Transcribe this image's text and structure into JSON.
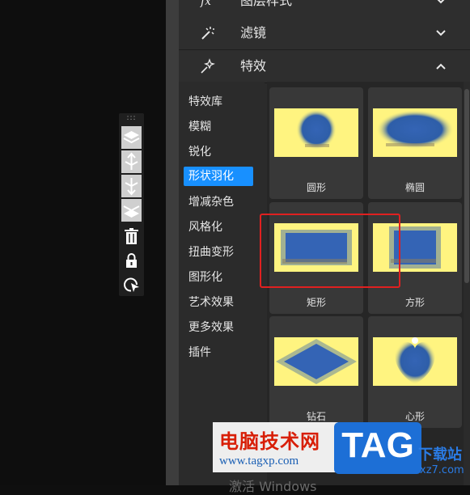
{
  "panel": {
    "sections": [
      {
        "label": "图层样式",
        "icon": "fx-icon",
        "state": "collapsed"
      },
      {
        "label": "滤镜",
        "icon": "magic-wand-icon",
        "state": "collapsed"
      },
      {
        "label": "特效",
        "icon": "sparkle-wand-icon",
        "state": "expanded"
      }
    ],
    "effect_categories": [
      {
        "label": "特效库"
      },
      {
        "label": "模糊"
      },
      {
        "label": "锐化"
      },
      {
        "label": "形状羽化",
        "selected": true
      },
      {
        "label": "增减杂色"
      },
      {
        "label": "风格化"
      },
      {
        "label": "扭曲变形"
      },
      {
        "label": "图形化"
      },
      {
        "label": "艺术效果"
      },
      {
        "label": "更多效果"
      },
      {
        "label": "插件"
      }
    ],
    "presets": [
      {
        "label": "圆形",
        "shape": "circle"
      },
      {
        "label": "椭圆",
        "shape": "ellipse"
      },
      {
        "label": "矩形",
        "shape": "rectangle",
        "highlighted": true
      },
      {
        "label": "方形",
        "shape": "square"
      },
      {
        "label": "钻石",
        "shape": "diamond"
      },
      {
        "label": "心形",
        "shape": "heart"
      }
    ]
  },
  "toolbar": {
    "items": [
      "layers-icon",
      "move-up-icon",
      "move-down-icon",
      "layers-bottom-icon",
      "trash-icon",
      "lock-icon",
      "select-cursor-icon"
    ]
  },
  "watermark": {
    "title": "电脑技术网",
    "url": "www.tagxp.com",
    "logo": "TAG",
    "side_text": "下载站",
    "side_url": "xz7.com",
    "activate_text": "激活 Windows"
  },
  "colors": {
    "accent": "#1890ff",
    "preview_bg": "#fff480",
    "preview_shape": "#2a5fb0",
    "highlight": "#e02020"
  }
}
